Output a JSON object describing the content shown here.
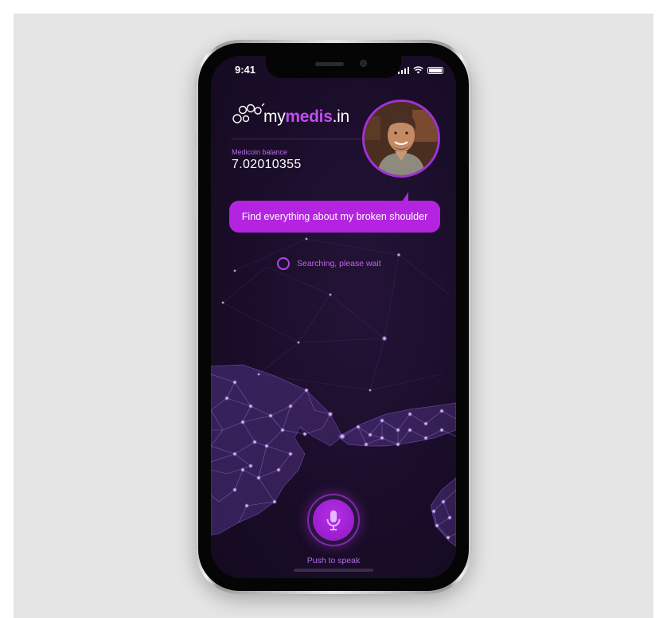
{
  "status_bar": {
    "time": "9:41",
    "icons": [
      "signal-icon",
      "wifi-icon",
      "battery-icon"
    ]
  },
  "brand": {
    "logo_prefix": "my",
    "logo_highlight": "medis",
    "logo_suffix": ".in",
    "logo_icon": "molecule-icon"
  },
  "balance": {
    "label": "Medicoin balance",
    "value": "7.02010355"
  },
  "query": {
    "text": "Find everything about my broken shoulder"
  },
  "status": {
    "text": "Searching, please wait"
  },
  "mic": {
    "label": "Push to speak",
    "icon": "microphone-icon"
  },
  "colors": {
    "accent": "#b424e0",
    "background": "#1a0d29",
    "text_accent": "#c064ee"
  }
}
